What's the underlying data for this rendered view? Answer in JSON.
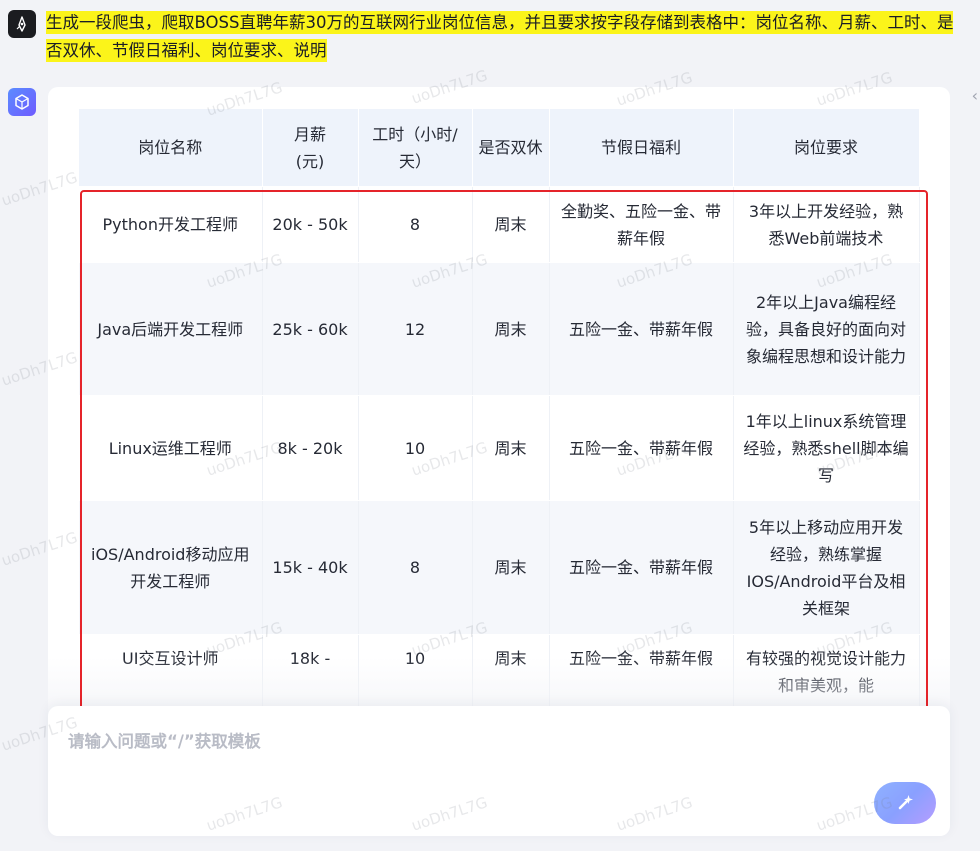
{
  "user": {
    "message": "生成一段爬虫，爬取BOSS直聘年薪30万的互联网行业岗位信息，并且要求按字段存储到表格中：岗位名称、月薪、工时、是否双休、节假日福利、岗位要求、说明"
  },
  "table": {
    "headers": [
      "岗位名称",
      "月薪\n(元)",
      "工时（小时/天）",
      "是否双休",
      "节假日福利",
      "岗位要求"
    ],
    "rows": [
      [
        "Python开发工程师",
        "20k - 50k",
        "8",
        "周末",
        "全勤奖、五险一金、带薪年假",
        "3年以上开发经验，熟悉Web前端技术"
      ],
      [
        "Java后端开发工程师",
        "25k - 60k",
        "12",
        "周末",
        "五险一金、带薪年假",
        "2年以上Java编程经验，具备良好的面向对象编程思想和设计能力"
      ],
      [
        "Linux运维工程师",
        "8k - 20k",
        "10",
        "周末",
        "五险一金、带薪年假",
        "1年以上linux系统管理经验，熟悉shell脚本编写"
      ],
      [
        "iOS/Android移动应用开发工程师",
        "15k - 40k",
        "8",
        "周末",
        "五险一金、带薪年假",
        "5年以上移动应用开发经验，熟练掌握IOS/Android平台及相关框架"
      ],
      [
        "UI交互设计师",
        "18k - ",
        "10",
        "周末",
        "五险一金、带薪年假",
        "有较强的视觉设计能力和审美观，能"
      ]
    ]
  },
  "input": {
    "placeholder": "请输入问题或“/”获取模板"
  },
  "watermark": {
    "text": "uoDh7L7G"
  },
  "icons": {
    "user_avatar": "ink-pen-icon",
    "assistant_avatar": "cube-logo-icon",
    "send": "sparkle-send-icon",
    "collapse": "chevron-left-icon"
  },
  "colors": {
    "highlight": "#fbf41a",
    "annotation_box": "#e5242a",
    "table_header_bg": "#eef3fb",
    "send_button": "#8fa6ff"
  }
}
